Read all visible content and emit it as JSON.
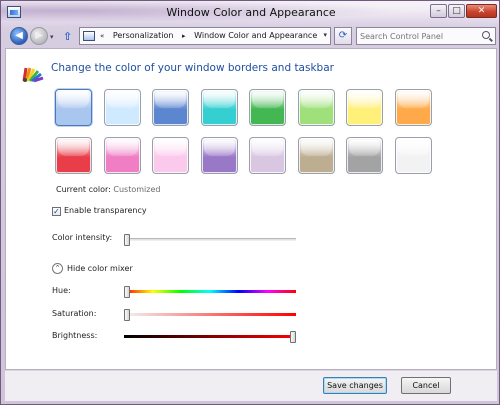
{
  "window": {
    "title": "Window Color and Appearance",
    "buttons": {
      "minimize": "–",
      "maximize": "□",
      "close": "✕"
    }
  },
  "navigation": {
    "back_glyph": "◀",
    "forward_glyph": "▶",
    "dropdown_glyph": "▾",
    "up_glyph": "⇧",
    "overflow_glyph": "«",
    "crumbs": [
      "Personalization",
      "Window Color and Appearance"
    ],
    "crumb_separator": "▸",
    "refresh_glyph": "⟳",
    "search_placeholder": "Search Control Panel"
  },
  "content": {
    "heading": "Change the color of your window borders and taskbar",
    "swatches_row1": [
      {
        "name": "custom-palette",
        "color": "#a9c6ee",
        "selected": true
      },
      {
        "name": "sky",
        "color": "#cfe9ff"
      },
      {
        "name": "twilight",
        "color": "#5c86cf"
      },
      {
        "name": "sea",
        "color": "#35cfd2"
      },
      {
        "name": "leaf",
        "color": "#43b852"
      },
      {
        "name": "lime",
        "color": "#9fe07a"
      },
      {
        "name": "lemon",
        "color": "#fff07a"
      },
      {
        "name": "tangerine",
        "color": "#ffaa4a"
      }
    ],
    "swatches_row2": [
      {
        "name": "ruby",
        "color": "#ea3d4a"
      },
      {
        "name": "fuchsia",
        "color": "#f07ec4"
      },
      {
        "name": "blush",
        "color": "#fbc9ec"
      },
      {
        "name": "violet",
        "color": "#9a78c8"
      },
      {
        "name": "lavender",
        "color": "#d9c7e2"
      },
      {
        "name": "taupe",
        "color": "#bdae92"
      },
      {
        "name": "slate",
        "color": "#a3a3a3"
      },
      {
        "name": "frost",
        "color": "#f2f2f2"
      }
    ],
    "current_color_label": "Current color:",
    "current_color_value": "Customized",
    "transparency_checked": true,
    "transparency_label": "Enable transparency",
    "check_glyph": "✓",
    "intensity_label": "Color intensity:",
    "intensity_level": 0.02,
    "mixer_toggle_glyph": "⌃",
    "mixer_label": "Hide color mixer",
    "hue_label": "Hue:",
    "hue_level": 0.02,
    "saturation_label": "Saturation:",
    "saturation_level": 0.02,
    "brightness_label": "Brightness:",
    "brightness_level": 0.98
  },
  "footer": {
    "save_label": "Save changes",
    "cancel_label": "Cancel"
  }
}
